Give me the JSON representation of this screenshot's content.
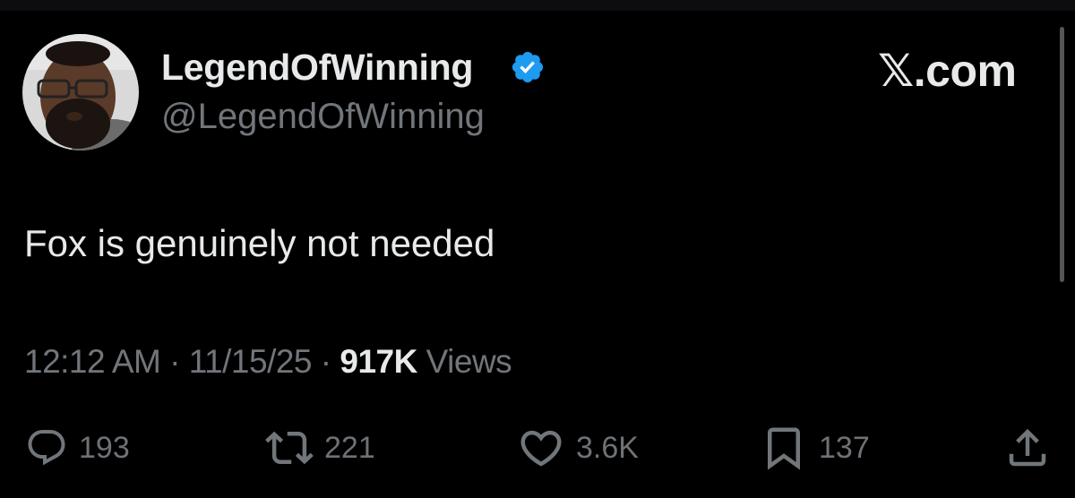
{
  "author": {
    "display_name": "LegendOfWinning",
    "handle": "@LegendOfWinning",
    "verified": true,
    "verified_color": "#1d9bf0"
  },
  "brand": {
    "label": "𝕏.com"
  },
  "tweet": {
    "text": "Fox is genuinely not needed",
    "time": "12:12 AM",
    "separator": "·",
    "date": "11/15/25",
    "views_count": "917K",
    "views_label": "Views"
  },
  "actions": {
    "reply": {
      "icon": "reply-icon",
      "count": "193"
    },
    "retweet": {
      "icon": "retweet-icon",
      "count": "221"
    },
    "like": {
      "icon": "heart-icon",
      "count": "3.6K"
    },
    "bookmark": {
      "icon": "bookmark-icon",
      "count": "137"
    },
    "share": {
      "icon": "share-icon"
    }
  },
  "colors": {
    "background": "#000000",
    "primary_text": "#e7e9ea",
    "secondary_text": "#71767b"
  }
}
